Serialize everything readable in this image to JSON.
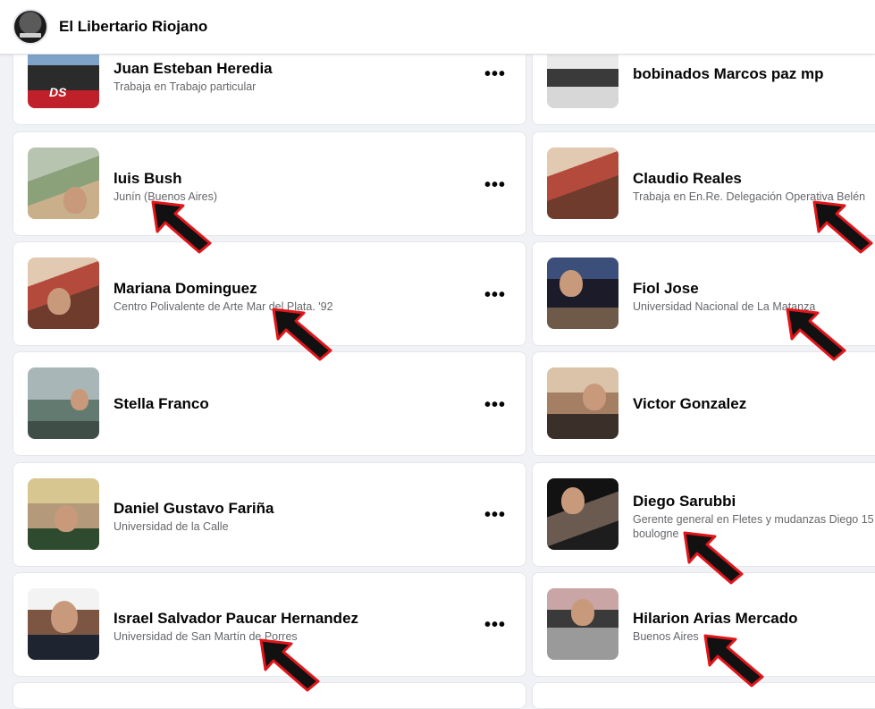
{
  "header": {
    "page_name": "El Libertario Riojano",
    "logo_icon": "page-logo"
  },
  "more_label": "•••",
  "people": [
    {
      "name": "Juan Esteban Heredia",
      "subtitle": "Trabaja en Trabajo particular"
    },
    {
      "name": "bobinados Marcos paz mp",
      "subtitle": ""
    },
    {
      "name": "luis Bush",
      "subtitle": "Junín (Buenos Aires)"
    },
    {
      "name": "Claudio Reales",
      "subtitle": "Trabaja en En.Re. Delegación Operativa Belén"
    },
    {
      "name": "Mariana Dominguez",
      "subtitle": "Centro Polivalente de Arte Mar del Plata. '92"
    },
    {
      "name": "Fiol Jose",
      "subtitle": "Universidad Nacional de La Matanza"
    },
    {
      "name": "Stella Franco",
      "subtitle": ""
    },
    {
      "name": "Victor Gonzalez",
      "subtitle": ""
    },
    {
      "name": "Daniel Gustavo Fariña",
      "subtitle": "Universidad de la Calle"
    },
    {
      "name": "Diego Sarubbi",
      "subtitle": "Gerente general en Fletes y mudanzas Diego 15 boulogne"
    },
    {
      "name": "Israel Salvador Paucar Hernandez",
      "subtitle": "Universidad de San Martín de Porres"
    },
    {
      "name": "Hilarion Arias Mercado",
      "subtitle": "Buenos Aires"
    }
  ],
  "colors": {
    "arrow_fill": "#111111",
    "arrow_stroke": "#e0161b",
    "card_bg": "#ffffff",
    "page_bg": "#f0f2f5"
  }
}
